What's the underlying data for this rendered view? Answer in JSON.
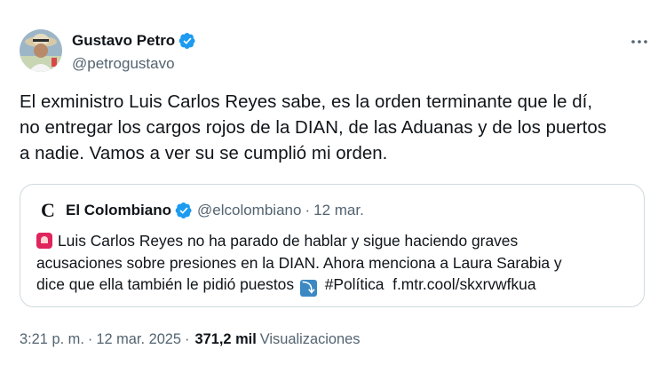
{
  "author": {
    "name": "Gustavo Petro",
    "handle": "@petrogustavo",
    "verified_icon": "verified-badge-icon",
    "verified_color": "#1d9bf0"
  },
  "menu": {
    "icon": "more-options-icon"
  },
  "tweet": {
    "line1": "El exministro Luis Carlos Reyes sabe, es la orden terminante que le dí,",
    "line2": "no entregar los cargos rojos de la DIAN, de las Aduanas y de los puertos",
    "line3": "a nadie. Vamos a ver su se cumplió mi orden."
  },
  "quote": {
    "logo": "C",
    "name": "El Colombiano",
    "handle": "@elcolombiano",
    "dot": "·",
    "time": "12 mar.",
    "siren_icon": "rotating-light-emoji",
    "arrow_icon": "arrow-heading-down-emoji",
    "arrow_glyph": "⤵",
    "line1": "Luis Carlos Reyes no ha parado de hablar y sigue haciendo graves",
    "line2": "acusaciones sobre presiones en la DIAN. Ahora menciona a Laura Sarabia y",
    "line3": "dice que ella también le pidió puestos",
    "hashtag": "#Política",
    "link": "f.mtr.cool/skxrvwfkua"
  },
  "meta": {
    "time": "3:21 p. m.",
    "sep1": "·",
    "date": "12 mar. 2025",
    "sep2": "·",
    "views_count": "371,2 mil",
    "views_label": "Visualizaciones"
  }
}
